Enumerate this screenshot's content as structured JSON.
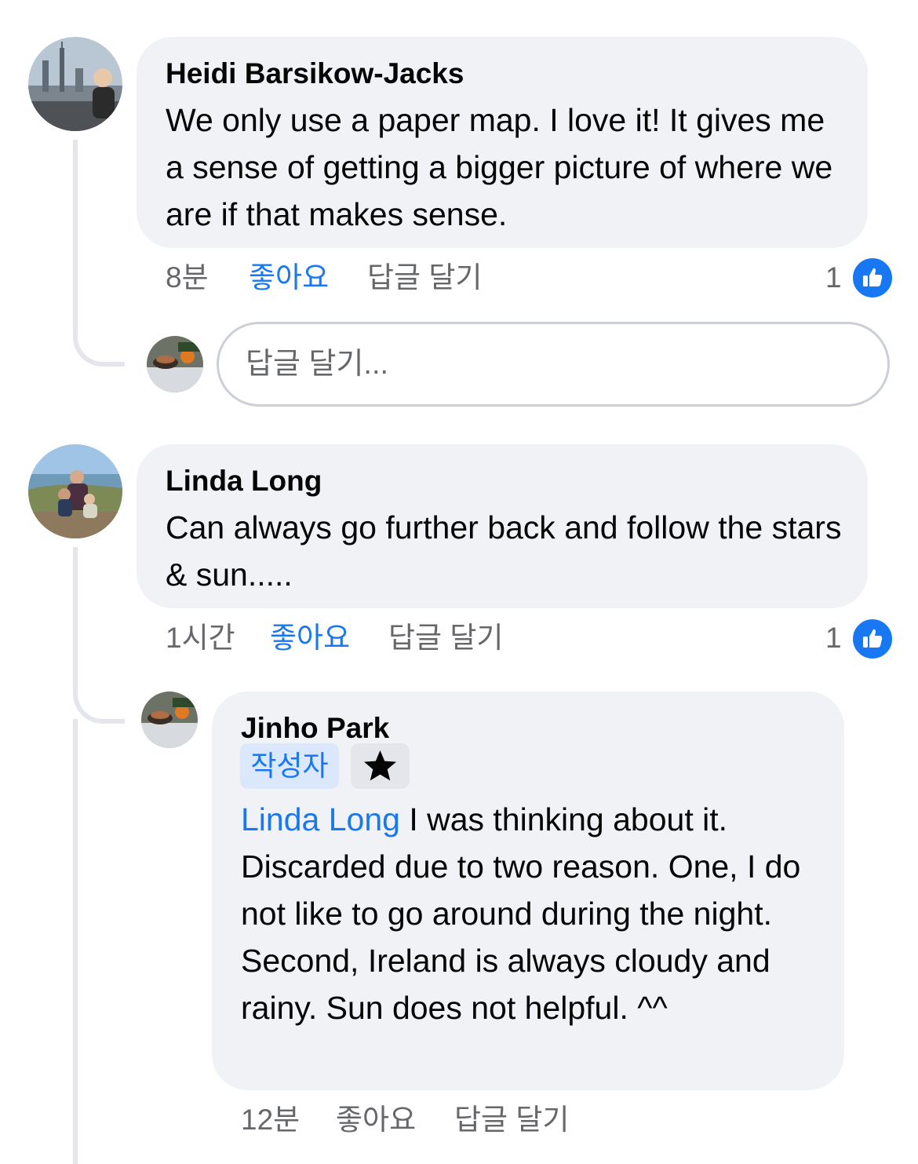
{
  "comments": [
    {
      "author": "Heidi Barsikow-Jacks",
      "text": "We only use a paper map. I love it! It gives me a sense of getting a bigger picture of where we are if that makes sense.",
      "time": "8분",
      "like_label": "좋아요",
      "reply_label": "답글 달기",
      "reaction_count": "1"
    },
    {
      "author": "Linda Long",
      "text": "Can always go further back and follow the stars & sun.....",
      "time": "1시간",
      "like_label": "좋아요",
      "reply_label": "답글 달기",
      "reaction_count": "1"
    }
  ],
  "reply_box": {
    "placeholder": "답글 달기..."
  },
  "reply": {
    "author": "Jinho Park",
    "author_badge": "작성자",
    "badge_icon": "star-icon",
    "mention": "Linda Long",
    "text": " I was thinking about it. Discarded due to two reason. One, I do not like to go around during the night. Second, Ireland is always cloudy and rainy. Sun does not helpful. ^^",
    "time": "12분",
    "like_label": "좋아요",
    "reply_label": "답글 달기"
  },
  "colors": {
    "accent": "#1877f2",
    "bubble": "#f0f2f5",
    "meta": "#65676b"
  }
}
